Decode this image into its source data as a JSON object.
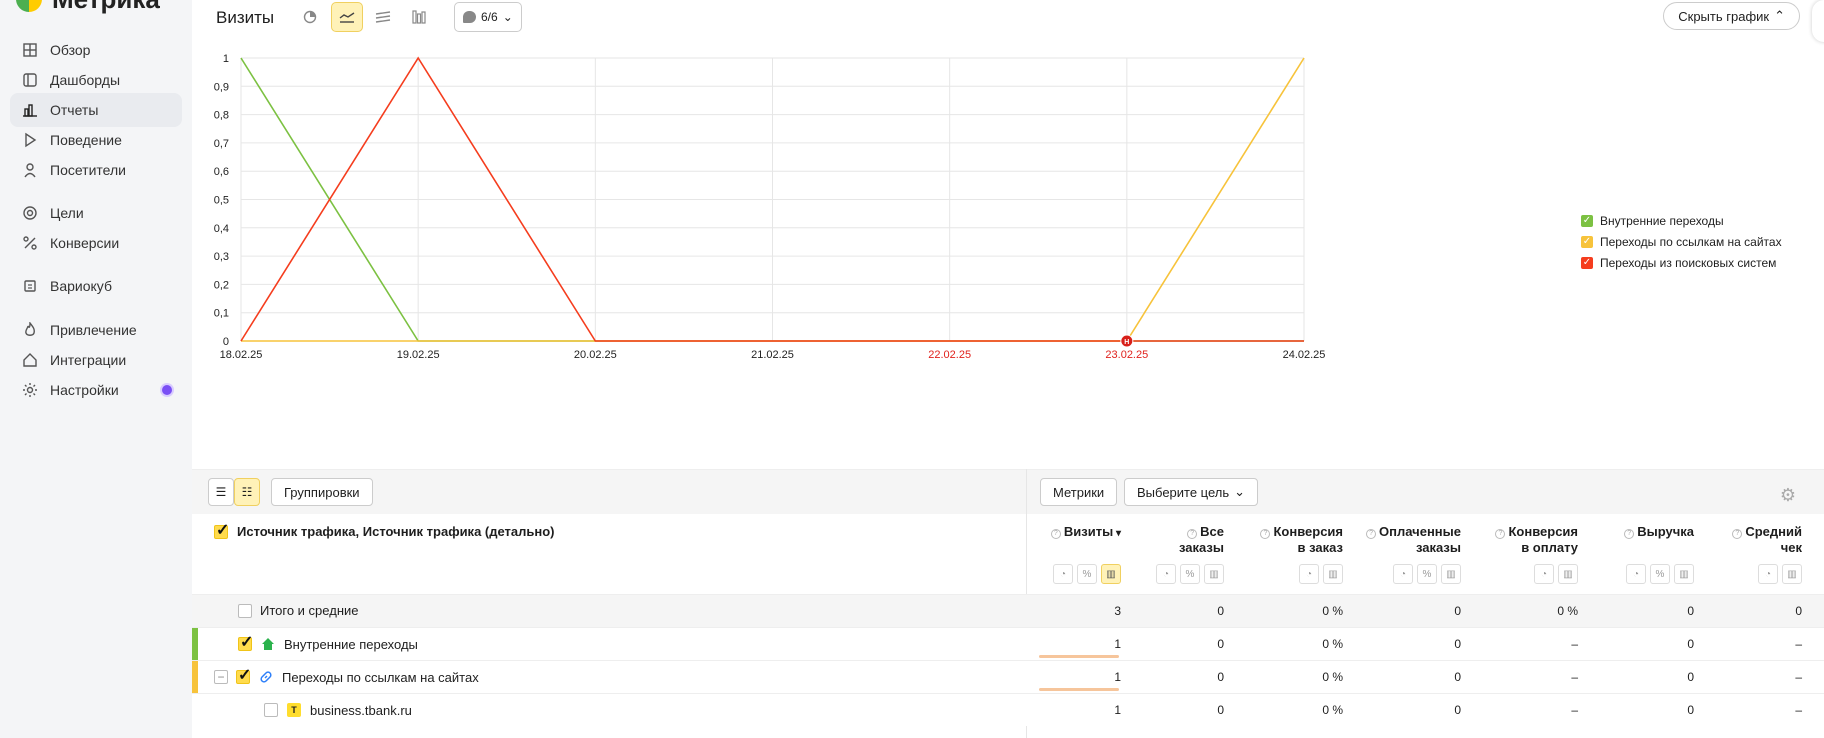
{
  "brand": {
    "name": "Метрика"
  },
  "sidebar": {
    "items": [
      {
        "label": "Обзор",
        "icon": "grid-icon"
      },
      {
        "label": "Дашборды",
        "icon": "dashboard-icon"
      },
      {
        "label": "Отчеты",
        "icon": "bar-chart-icon",
        "active": true
      },
      {
        "label": "Поведение",
        "icon": "play-icon"
      },
      {
        "label": "Посетители",
        "icon": "user-icon"
      },
      {
        "label": "Цели",
        "icon": "target-icon"
      },
      {
        "label": "Конверсии",
        "icon": "percent-icon"
      },
      {
        "label": "Вариокуб",
        "icon": "cube-icon"
      },
      {
        "label": "Привлечение",
        "icon": "flame-icon"
      },
      {
        "label": "Интеграции",
        "icon": "home-icon"
      },
      {
        "label": "Настройки",
        "icon": "gear-icon"
      }
    ]
  },
  "toolbar": {
    "title": "Визиты",
    "segments": "6/6",
    "hide_chart": "Скрыть график"
  },
  "chart_data": {
    "type": "line",
    "x": [
      "18.02.25",
      "19.02.25",
      "20.02.25",
      "21.02.25",
      "22.02.25",
      "23.02.25",
      "24.02.25"
    ],
    "weekend_x": [
      "22.02.25",
      "23.02.25"
    ],
    "yticks": [
      "0",
      "0,1",
      "0,2",
      "0,3",
      "0,4",
      "0,5",
      "0,6",
      "0,7",
      "0,8",
      "0,9",
      "1"
    ],
    "ylim": [
      0,
      1
    ],
    "series": [
      {
        "name": "Внутренние переходы",
        "color": "#7cc142",
        "values": [
          1,
          0,
          0,
          0,
          0,
          0,
          0
        ]
      },
      {
        "name": "Переходы по ссылкам на сайтах",
        "color": "#f7c33b",
        "values": [
          0,
          0,
          0,
          0,
          0,
          0,
          1
        ]
      },
      {
        "name": "Переходы из поисковых систем",
        "color": "#f53d1e",
        "values": [
          0,
          1,
          0,
          0,
          0,
          0,
          0
        ]
      }
    ],
    "annotation": {
      "x": "23.02.25",
      "label": "H"
    },
    "legend": "right"
  },
  "table_toolbar": {
    "groupings": "Группировки",
    "metrics": "Метрики",
    "goal": "Выберите цель"
  },
  "table": {
    "dimension_header": "Источник трафика, Источник трафика (детально)",
    "columns": [
      {
        "line1": "Визиты",
        "line2": "",
        "sort": "▾"
      },
      {
        "line1": "Все",
        "line2": "заказы"
      },
      {
        "line1": "Конверсия",
        "line2": "в заказ"
      },
      {
        "line1": "Оплаченные",
        "line2": "заказы"
      },
      {
        "line1": "Конверсия",
        "line2": "в оплату"
      },
      {
        "line1": "Выручка",
        "line2": ""
      },
      {
        "line1": "Средний",
        "line2": "чек"
      }
    ],
    "rows": [
      {
        "label": "Итого и средние",
        "values": [
          "3",
          "0",
          "0 %",
          "0",
          "0 %",
          "0",
          "0"
        ]
      },
      {
        "label": "Внутренние переходы",
        "values": [
          "1",
          "0",
          "0 %",
          "0",
          "–",
          "0",
          "–"
        ],
        "accent": "#7cc142"
      },
      {
        "label": "Переходы по ссылкам на сайтах",
        "values": [
          "1",
          "0",
          "0 %",
          "0",
          "–",
          "0",
          "–"
        ],
        "accent": "#f7c33b"
      },
      {
        "label": "business.tbank.ru",
        "values": [
          "1",
          "0",
          "0 %",
          "0",
          "–",
          "0",
          "–"
        ]
      }
    ]
  }
}
